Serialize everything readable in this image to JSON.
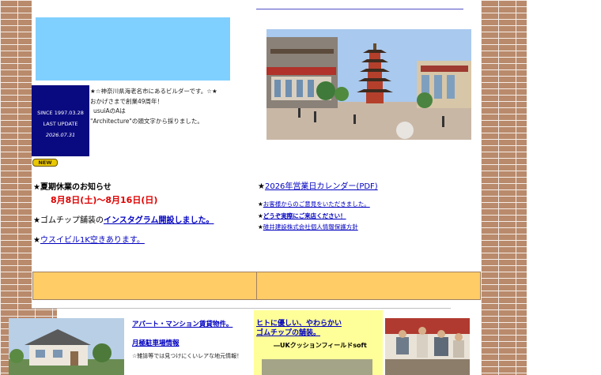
{
  "since": {
    "since_label": "SINCE 1997.03.28",
    "update_label": "LAST UPDATE",
    "update_date": "2026.07.31"
  },
  "intro": {
    "line1": "★☆神奈川県海老名市にあるビルダーです。☆★",
    "line2": "おかげさまで創業49周年！",
    "line3": "usuiAのAは",
    "line4": "\"Architecture\"の頭文字から採りました。"
  },
  "new_badge": "NEW",
  "news": {
    "summer_title": "★夏期休業のお知らせ",
    "summer_dates": "8月8日(土)～8月16日(日)",
    "rubber_prefix": "★ゴムチップ舗装の",
    "rubber_link": "インスタグラム開設しました。",
    "vacancy_prefix": "★",
    "vacancy_link": "ウスイビル1K空きあります。"
  },
  "right_links": {
    "calendar_prefix": "★",
    "calendar_link": "2026年営業日カレンダー(PDF)",
    "opinion_prefix": "★",
    "opinion_link": "お客様からのご意見をいただきました。",
    "visit_prefix": "★",
    "visit_link": "どうぞ実際にご来店ください！",
    "privacy_prefix": "★",
    "privacy_link": "碓井建設株式会社個人情報保護方針"
  },
  "bottom": {
    "rental_link": "アパート・マンション賃貸物件。",
    "parking_link": "月極駐車場情報",
    "note": "☆雑誌等では見つけにくいレアな地元情報！",
    "rubber_line1": "ヒトに優しい、やわらかい",
    "rubber_line2": "ゴムチップの舗装。",
    "rubber_sub": "―UKクッションフィールドsoft"
  },
  "colors": {
    "brick": "#b98a6b",
    "banner": "#80d0ff",
    "since_bg": "#0a0a80",
    "orange": "#ffcc66",
    "yellow": "#ffff99",
    "link": "#0000c0",
    "accent_red": "#e00000"
  }
}
